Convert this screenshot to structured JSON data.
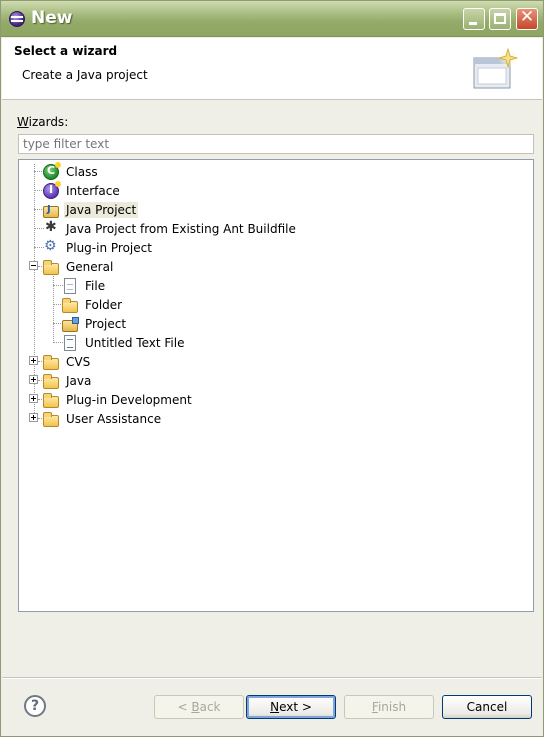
{
  "window": {
    "title": "New",
    "controls": {
      "minimize": "minimize",
      "maximize": "maximize",
      "close": "✕"
    }
  },
  "header": {
    "title": "Select a wizard",
    "description": "Create a Java project"
  },
  "filter": {
    "label_underlined": "W",
    "label_rest": "izards:",
    "placeholder": "type filter text"
  },
  "tree": {
    "items": [
      {
        "label": "Class",
        "icon": "class-icon"
      },
      {
        "label": "Interface",
        "icon": "interface-icon"
      },
      {
        "label": "Java Project",
        "icon": "java-project-icon",
        "selected": true
      },
      {
        "label": "Java Project from Existing Ant Buildfile",
        "icon": "ant-icon"
      },
      {
        "label": "Plug-in Project",
        "icon": "plugin-project-icon"
      },
      {
        "label": "General",
        "icon": "folder-open-icon",
        "expanded": true
      },
      {
        "label": "File",
        "icon": "file-icon"
      },
      {
        "label": "Folder",
        "icon": "folder-icon"
      },
      {
        "label": "Project",
        "icon": "project-icon"
      },
      {
        "label": "Untitled Text File",
        "icon": "text-file-icon"
      },
      {
        "label": "CVS",
        "icon": "folder-icon",
        "expanded": false
      },
      {
        "label": "Java",
        "icon": "folder-icon",
        "expanded": false
      },
      {
        "label": "Plug-in Development",
        "icon": "folder-icon",
        "expanded": false
      },
      {
        "label": "User Assistance",
        "icon": "folder-icon",
        "expanded": false
      }
    ]
  },
  "buttons": {
    "help": "?",
    "back_prefix": "< ",
    "back_underlined": "B",
    "back_rest": "ack",
    "next_underlined": "N",
    "next_rest": "ext >",
    "finish_underlined": "F",
    "finish_rest": "inish",
    "cancel": "Cancel"
  }
}
